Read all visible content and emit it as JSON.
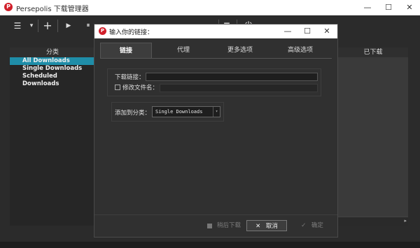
{
  "window": {
    "title": "Persepolis 下载管理器",
    "icon_letter": "P",
    "minimize": "—",
    "maximize": "☐",
    "close": "✕"
  },
  "toolbar": {
    "menu_icon": "☰",
    "dropdown_icon": "▾",
    "add_icon": "+",
    "play_icon": "▶",
    "pause_icon": "⏸",
    "stop_icon": "■",
    "remove_icon": "✕",
    "delete_icon": "🗑",
    "queue_icon": "▬",
    "queue2_icon": "▭",
    "power_icon": "⏻"
  },
  "sidebar": {
    "header": "分类",
    "items": [
      {
        "label": "All Downloads",
        "selected": true
      },
      {
        "label": "Single Downloads",
        "selected": false
      },
      {
        "label": "Scheduled Downloads",
        "selected": false
      }
    ]
  },
  "downloads": {
    "header": "已下载",
    "scroll_right": "▸"
  },
  "dialog": {
    "title": "输入你的链接：",
    "icon_letter": "P",
    "minimize": "—",
    "maximize": "☐",
    "close": "✕",
    "tabs": [
      "链接",
      "代理",
      "更多选项",
      "高级选项"
    ],
    "active_tab": "链接",
    "link_label": "下载链接：",
    "link_value": "",
    "rename_label": "修改文件名：",
    "rename_checked": false,
    "rename_value": "",
    "category_label": "添加到分类：",
    "category_value": "Single Downloads",
    "category_arrow": "▾",
    "download_later_label": "稍后下载",
    "download_later_checked": true,
    "cancel_label": "取消",
    "cancel_icon": "✕",
    "ok_label": "确定",
    "ok_icon": "✓"
  },
  "colors": {
    "accent": "#1f8da8",
    "background": "#2b2b2b",
    "titlebar": "#ffffff",
    "app_icon": "#d11f2a"
  }
}
